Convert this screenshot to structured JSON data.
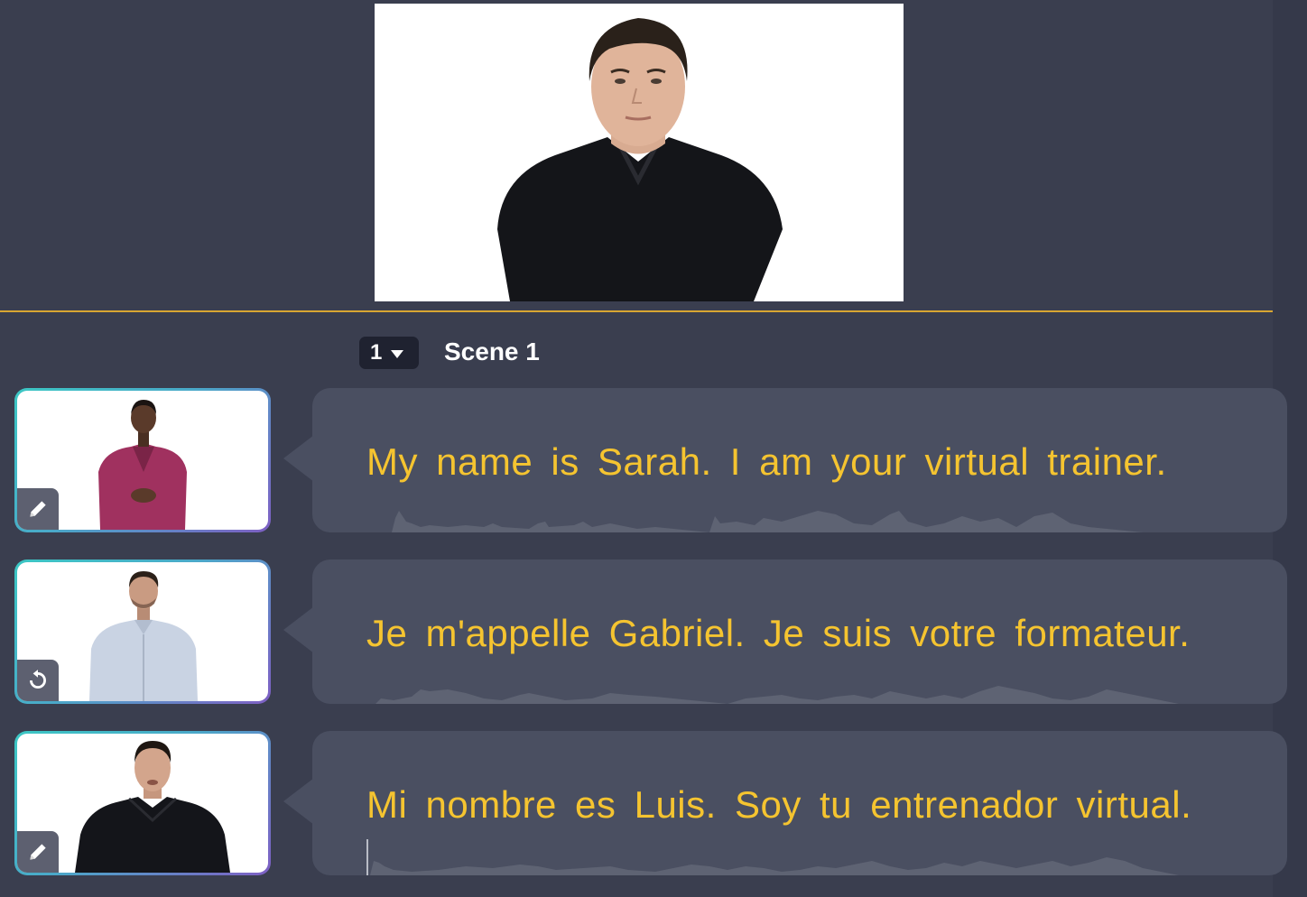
{
  "scene": {
    "number": "1",
    "title": "Scene 1"
  },
  "preview": {
    "presenter": "Luis"
  },
  "rows": [
    {
      "text": "My name is Sarah. I am your virtual trainer.",
      "action_icon": "pencil-icon",
      "avatar": {
        "skin": "#5a3a2a",
        "hair": "#1b1412",
        "top": "#a0315f"
      }
    },
    {
      "text": "Je m'appelle Gabriel. Je suis votre formateur.",
      "action_icon": "reset-icon",
      "avatar": {
        "skin": "#c99b82",
        "hair": "#2b2018",
        "top": "#c9d3e3"
      }
    },
    {
      "text": "Mi nombre es Luis. Soy tu entrenador virtual.",
      "action_icon": "pencil-icon",
      "avatar": {
        "skin": "#d3a58c",
        "hair": "#1e1712",
        "top": "#14151a"
      }
    }
  ],
  "colors": {
    "background": "#3a3e4f",
    "bubble": "#4a4f61",
    "script_text": "#f5c430",
    "divider": "#d8a632",
    "thumb_border_start": "#3cc7c4",
    "thumb_border_end": "#7e5fc4"
  }
}
